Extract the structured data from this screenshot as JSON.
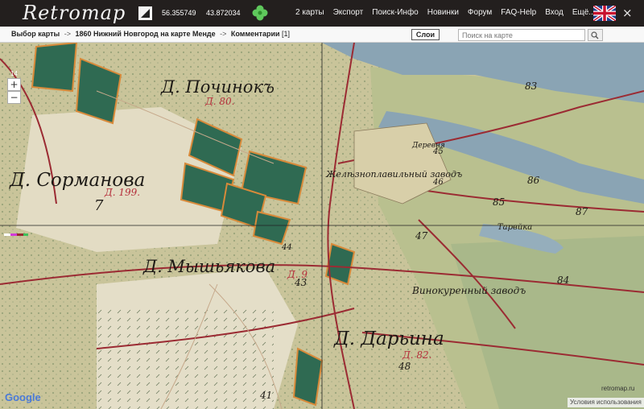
{
  "topbar": {
    "logo": "Retromap",
    "latitude": "56.355749",
    "longitude": "43.872034",
    "menu": [
      "2 карты",
      "Экспорт",
      "Поиск-Инфо",
      "Новинки",
      "Форум",
      "FAQ-Help",
      "Вход",
      "Ещё..."
    ],
    "close": "×"
  },
  "breadcrumb": {
    "root": "Выбор карты",
    "separator": "->",
    "map_title": "1860 Нижний Новгород на карте Менде",
    "comments_label": "Комментарии",
    "comments_count": "[1]"
  },
  "layers_button": "Слои",
  "search": {
    "placeholder": "Поиск на карте"
  },
  "zoom": {
    "level": "14",
    "plus": "+",
    "minus": "−"
  },
  "map_labels": {
    "pochinok": "Д. Починокъ",
    "pochinok_num": "Д. 80.",
    "sormanova": "Д. Сорманова",
    "sormanova_num": "Д. 199.",
    "myshyakova": "Д. Мышьякова",
    "myshyakova_num": "Д. 9",
    "darina": "Д. Дарьина",
    "darina_num": "Д. 82.",
    "vinokurenny": "Винокуренный заводъ",
    "zhelezo": "Желѣзноплавильный заводъ",
    "derevnya": "Деревня",
    "tarvyka": "Тарвйка",
    "n7": "7",
    "n83": "83",
    "n45": "45",
    "n46": "46",
    "n86": "86",
    "n85": "85",
    "n87": "87",
    "n47": "47",
    "n44": "44",
    "n43": "43",
    "n84": "84",
    "n48": "48",
    "n41": "41"
  },
  "footer": {
    "google": "Google",
    "brand": "retromap.ru",
    "terms": "Условия использования"
  },
  "colors": {
    "topbar_bg": "#231f1e",
    "river": "#8aa4b4",
    "forest": "#2f6a52",
    "road": "#9b2b33"
  }
}
